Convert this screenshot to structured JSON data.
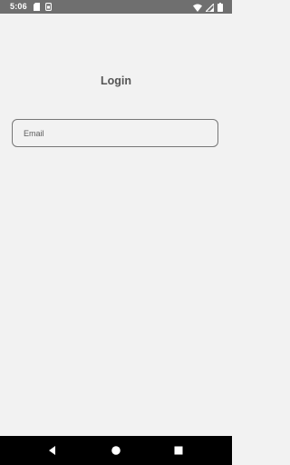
{
  "status_bar": {
    "time": "5:06",
    "left_icons": [
      "sd-card-icon",
      "sim-icon"
    ],
    "right_icons": [
      "wifi-icon",
      "signal-icon",
      "battery-icon"
    ]
  },
  "login": {
    "title": "Login",
    "email_placeholder": "Email",
    "email_value": ""
  },
  "nav_bar": {
    "buttons": [
      "back-icon",
      "home-icon",
      "recents-icon"
    ]
  },
  "colors": {
    "background": "#f2f2f2",
    "status_bar": "#6f6f6f",
    "title_text": "#555555",
    "field_border": "#777777",
    "nav_bar": "#000000"
  }
}
